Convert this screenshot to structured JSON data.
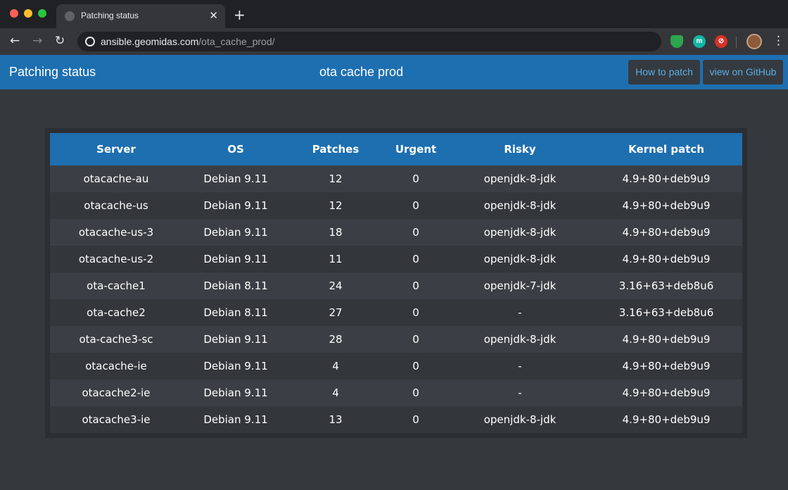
{
  "browser": {
    "tab_title": "Patching status",
    "tab_close": "✕",
    "new_tab": "+",
    "url_host": "ansible.geomidas.com",
    "url_path": "/ota_cache_prod/",
    "ext_m": "m"
  },
  "header": {
    "title": "Patching status",
    "subtitle": "ota cache prod",
    "how_to_patch": "How to patch",
    "view_github": "view on GitHub"
  },
  "table": {
    "columns": [
      "Server",
      "OS",
      "Patches",
      "Urgent",
      "Risky",
      "Kernel patch"
    ],
    "rows": [
      [
        "otacache-au",
        "Debian 9.11",
        "12",
        "0",
        "openjdk-8-jdk",
        "4.9+80+deb9u9"
      ],
      [
        "otacache-us",
        "Debian 9.11",
        "12",
        "0",
        "openjdk-8-jdk",
        "4.9+80+deb9u9"
      ],
      [
        "otacache-us-3",
        "Debian 9.11",
        "18",
        "0",
        "openjdk-8-jdk",
        "4.9+80+deb9u9"
      ],
      [
        "otacache-us-2",
        "Debian 9.11",
        "11",
        "0",
        "openjdk-8-jdk",
        "4.9+80+deb9u9"
      ],
      [
        "ota-cache1",
        "Debian 8.11",
        "24",
        "0",
        "openjdk-7-jdk",
        "3.16+63+deb8u6"
      ],
      [
        "ota-cache2",
        "Debian 8.11",
        "27",
        "0",
        "-",
        "3.16+63+deb8u6"
      ],
      [
        "ota-cache3-sc",
        "Debian 9.11",
        "28",
        "0",
        "openjdk-8-jdk",
        "4.9+80+deb9u9"
      ],
      [
        "otacache-ie",
        "Debian 9.11",
        "4",
        "0",
        "-",
        "4.9+80+deb9u9"
      ],
      [
        "otacache2-ie",
        "Debian 9.11",
        "4",
        "0",
        "-",
        "4.9+80+deb9u9"
      ],
      [
        "otacache3-ie",
        "Debian 9.11",
        "13",
        "0",
        "openjdk-8-jdk",
        "4.9+80+deb9u9"
      ]
    ]
  },
  "colors": {
    "header_blue": "#1e6fb0",
    "page_bg": "#35383c",
    "button_bg": "#343a40",
    "button_text": "#5dade2"
  }
}
